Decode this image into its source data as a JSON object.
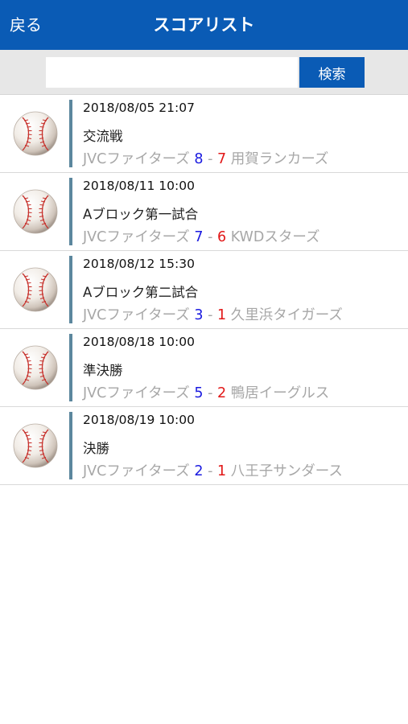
{
  "header": {
    "back_label": "戻る",
    "title": "スコアリスト"
  },
  "search": {
    "value": "",
    "placeholder": "",
    "button_label": "検索"
  },
  "colors": {
    "primary": "#0A5BB5",
    "home_score": "#1A1AE0",
    "away_score": "#E21818",
    "accent_bar": "#5C879E"
  },
  "icon": "baseball-icon",
  "games": [
    {
      "datetime": "2018/08/05 21:07",
      "title": "交流戦",
      "home_team": "JVCファイターズ",
      "home_score": "8",
      "separator": "-",
      "away_score": "7",
      "away_team": "用賀ランカーズ"
    },
    {
      "datetime": "2018/08/11 10:00",
      "title": "Aブロック第一試合",
      "home_team": "JVCファイターズ",
      "home_score": "7",
      "separator": "-",
      "away_score": "6",
      "away_team": "KWDスターズ"
    },
    {
      "datetime": "2018/08/12 15:30",
      "title": "Aブロック第二試合",
      "home_team": "JVCファイターズ",
      "home_score": "3",
      "separator": "-",
      "away_score": "1",
      "away_team": "久里浜タイガーズ"
    },
    {
      "datetime": "2018/08/18 10:00",
      "title": "準決勝",
      "home_team": "JVCファイターズ",
      "home_score": "5",
      "separator": "-",
      "away_score": "2",
      "away_team": "鴨居イーグルス"
    },
    {
      "datetime": "2018/08/19 10:00",
      "title": "決勝",
      "home_team": "JVCファイターズ",
      "home_score": "2",
      "separator": "-",
      "away_score": "1",
      "away_team": "八王子サンダース"
    }
  ]
}
